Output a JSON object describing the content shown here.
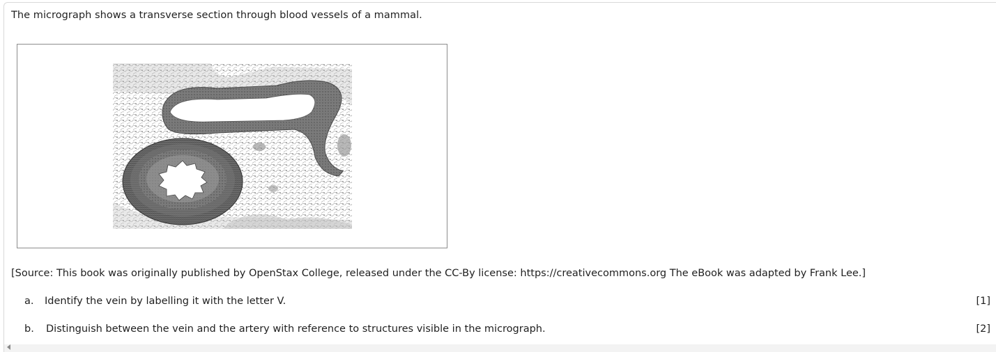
{
  "question": {
    "intro": "The micrograph shows a transverse section through blood vessels of a mammal.",
    "figure_icon": "micrograph-blood-vessels",
    "source": "[Source: This book was originally published by OpenStax College, released under the CC-By license: https://creativecommons.org The eBook was adapted by Frank Lee.]",
    "parts": [
      {
        "letter": "a.",
        "text": "Identify the vein by labelling it with the letter V.",
        "marks": "[1]"
      },
      {
        "letter": "b.",
        "text": "Distinguish between the vein and the artery with reference to structures visible in the micrograph.",
        "marks": "[2]"
      }
    ]
  }
}
